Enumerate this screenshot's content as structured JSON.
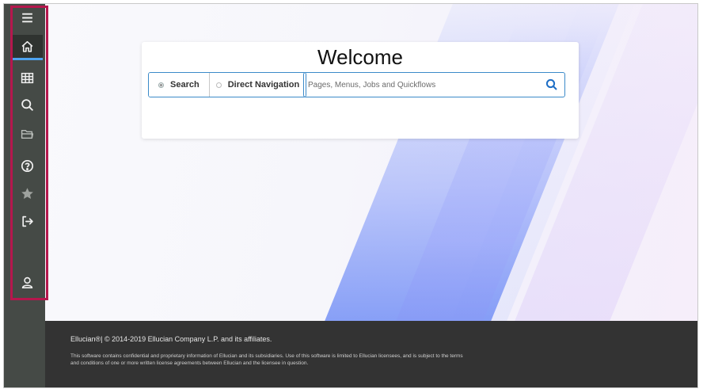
{
  "welcome": {
    "title": "Welcome"
  },
  "search": {
    "option_search": "Search",
    "option_direct": "Direct Navigation",
    "placeholder": "Pages, Menus, Jobs and Quickflows",
    "value": ""
  },
  "footer": {
    "copyright": "Ellucian®| © 2014-2019 Ellucian Company L.P. and its affiliates.",
    "legal": "This software contains confidential and proprietary information of Ellucian and its subsidiaries. Use of this software is limited to Ellucian licensees, and is subject to the terms and conditions of one or more written license agreements between Ellucian and the licensee in question."
  },
  "sidebar": {
    "items": [
      "menu-icon",
      "home-icon",
      "grid-icon",
      "search-icon",
      "folder-icon",
      "help-icon",
      "star-icon",
      "sign-out-icon",
      "user-icon"
    ]
  },
  "colors": {
    "accent": "#1f6fc6",
    "sidebar": "#454a46",
    "highlight": "#b5174d",
    "footer": "#333333"
  }
}
